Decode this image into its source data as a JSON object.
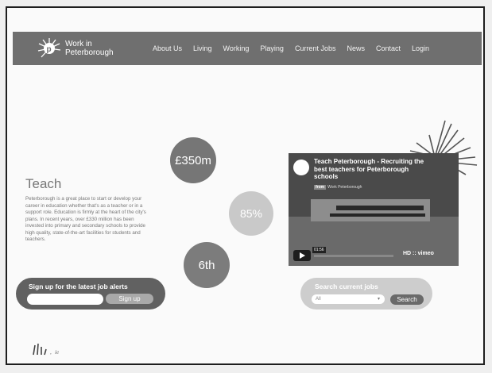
{
  "brand": {
    "line1": "Work in",
    "line2": "Peterborough"
  },
  "nav": [
    "About Us",
    "Living",
    "Working",
    "Playing",
    "Current Jobs",
    "News",
    "Contact",
    "Login"
  ],
  "teach": {
    "title": "Teach",
    "body": "Peterborough is a great place to start or develop your career in education whether that's as a teacher or in a support role. Education is firmly at the heart of the city's plans. In recent years, over £330 million has been invested into primary and secondary schools to provide high quality, state-of-the-art facilities for students and teachers."
  },
  "stats": [
    "£350m",
    "85%",
    "6th"
  ],
  "signup": {
    "label": "Sign up for the latest job alerts",
    "button": "Sign up",
    "placeholder": ""
  },
  "video": {
    "title": "Teach Peterborough - Recruiting the best teachers for Peterborough schools",
    "from_prefix": "from",
    "from_name": "Work Peterborough",
    "duration": "01:56",
    "controls": "HD :: vimeo"
  },
  "search": {
    "label": "Search current jobs",
    "select_value": "All",
    "button": "Search"
  },
  "colors": {
    "nav_bg": "#6f6f6f",
    "signup_bg": "#616161",
    "search_bg": "#cdcdcd"
  }
}
